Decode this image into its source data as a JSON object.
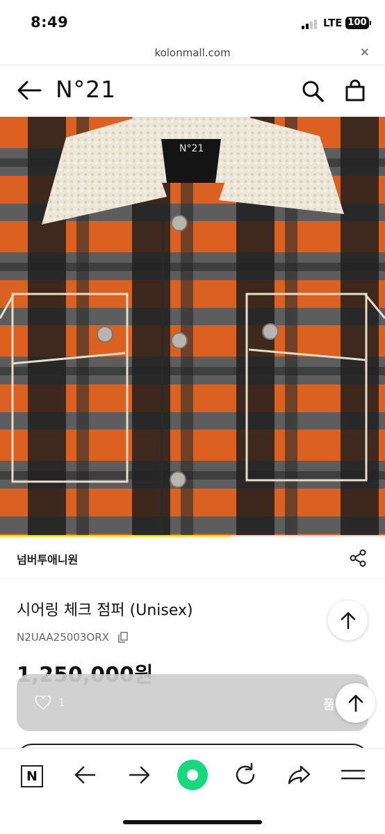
{
  "status_bar": {
    "time": "8:49",
    "network": "LTE",
    "battery": "100"
  },
  "address_bar": {
    "url": "kolonmall.com",
    "close_symbol": "✕"
  },
  "header": {
    "brand_logo": "N°21"
  },
  "product": {
    "image_label": "N°21",
    "image_progress_percent": 60,
    "brand": "넘버투애니원",
    "title": "시어링 체크 점퍼 (Unisex)",
    "code": "N2UAA25003ORX",
    "price": "1,250,000원"
  },
  "action_bar": {
    "like_count": "1",
    "status": "품절"
  },
  "toolbar": {
    "n_label": "N"
  },
  "colors": {
    "accent_green": "#19d77e",
    "progress": "#e0f13a",
    "plaid_orange": "#e8621c"
  }
}
